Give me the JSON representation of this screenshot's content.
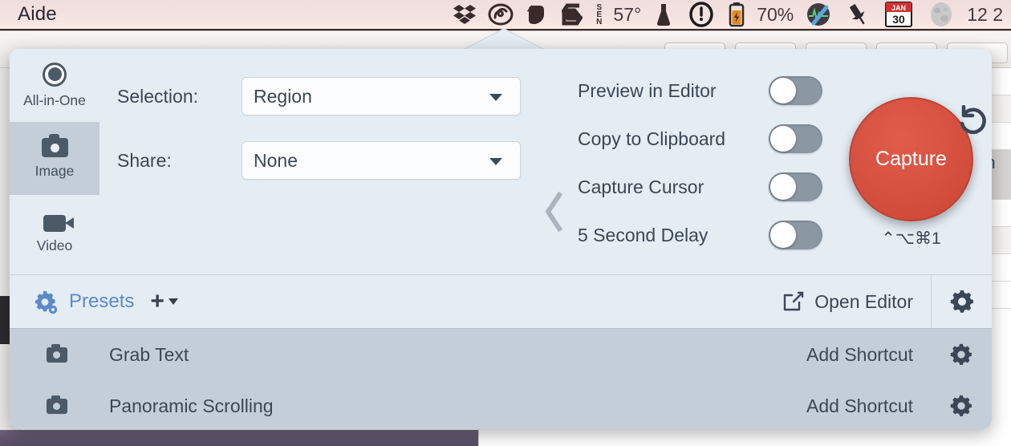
{
  "menubar": {
    "app_title": "Aide",
    "items": [
      {
        "name": "dropbox-icon",
        "type": "icon"
      },
      {
        "name": "creative-cloud-icon",
        "type": "icon"
      },
      {
        "name": "evernote-icon",
        "type": "icon"
      },
      {
        "name": "snagit-icon",
        "type": "icon"
      },
      {
        "name": "sen-indicator",
        "type": "text",
        "label": "SEN"
      },
      {
        "name": "temperature",
        "type": "text",
        "label": "57°"
      },
      {
        "name": "flask-icon",
        "type": "icon"
      },
      {
        "name": "circle-exclaim-icon",
        "type": "icon"
      },
      {
        "name": "battery-icon",
        "type": "icon"
      },
      {
        "name": "battery-percent",
        "type": "text",
        "label": "70%"
      },
      {
        "name": "istat-icon",
        "type": "icon"
      },
      {
        "name": "pin-icon",
        "type": "icon"
      },
      {
        "name": "calendar-icon",
        "type": "icon",
        "month": "JAN",
        "day": "30"
      },
      {
        "name": "moon-icon",
        "type": "icon"
      },
      {
        "name": "clock",
        "type": "text",
        "label": "12 2"
      }
    ]
  },
  "popover": {
    "modes": [
      {
        "label": "All-in-One",
        "icon": "record-ring-icon",
        "selected": false
      },
      {
        "label": "Image",
        "icon": "camera-icon",
        "selected": true
      },
      {
        "label": "Video",
        "icon": "video-camera-icon",
        "selected": false
      }
    ],
    "fields": [
      {
        "label": "Selection:",
        "value": "Region",
        "name": "selection"
      },
      {
        "label": "Share:",
        "value": "None",
        "name": "share"
      }
    ],
    "toggles": [
      {
        "label": "Preview in Editor",
        "on": false
      },
      {
        "label": "Copy to Clipboard",
        "on": false
      },
      {
        "label": "Capture Cursor",
        "on": false
      },
      {
        "label": "5 Second Delay",
        "on": false
      }
    ],
    "capture": {
      "label": "Capture",
      "shortcut": "⌃⌥⌘1",
      "color": "#d6503f"
    },
    "reset_icon": "undo-arrow-icon",
    "collapse_icon": "chevron-left-icon"
  },
  "presets": {
    "title": "Presets",
    "title_color": "#5c8ac7",
    "add_label": "+",
    "open_editor_label": "Open Editor",
    "gear_icon": "gear-icon",
    "rows": [
      {
        "name": "Grab Text",
        "shortcut": "Add Shortcut",
        "icon": "camera-icon"
      },
      {
        "name": "Panoramic Scrolling",
        "shortcut": "Add Shortcut",
        "icon": "camera-icon"
      }
    ]
  },
  "background": {
    "text_fragment": "on"
  }
}
